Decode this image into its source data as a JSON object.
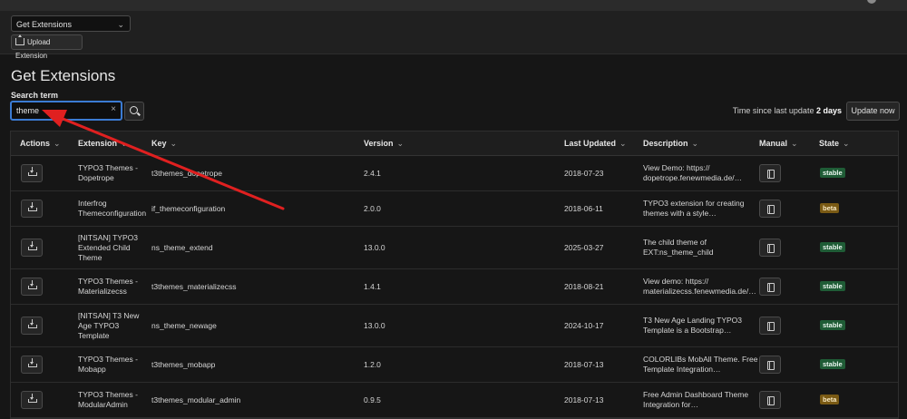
{
  "toolbar": {
    "select_value": "Get Extensions",
    "upload_label": "Upload Extension"
  },
  "page": {
    "title": "Get Extensions"
  },
  "search": {
    "label": "Search term",
    "value": "theme",
    "clear_symbol": "×"
  },
  "update": {
    "prefix": "Time since last update",
    "value": "2 days",
    "button_label": "Update now"
  },
  "columns": {
    "actions": "Actions",
    "extension": "Extension",
    "key": "Key",
    "version": "Version",
    "last_updated": "Last Updated",
    "description": "Description",
    "manual": "Manual",
    "state": "State"
  },
  "icons": {
    "sort": "chevron-down-icon",
    "action": "download-icon",
    "manual": "book-icon",
    "search": "search-icon",
    "upload": "upload-icon"
  },
  "colors": {
    "accent": "#3b7bd3",
    "stable": "#1f5c36",
    "beta": "#7a5a14",
    "annotation": "#e02020"
  },
  "rows": [
    {
      "extension": [
        "TYPO3 Themes -",
        "Dopetrope"
      ],
      "key": "t3themes_dopetrope",
      "version": "2.4.1",
      "last_updated": "2018-07-23",
      "description": [
        "View Demo: https://",
        "dopetrope.fenewmedia.de/…"
      ],
      "state": "stable"
    },
    {
      "extension": [
        "Interfrog",
        "Themeconfiguration"
      ],
      "key": "if_themeconfiguration",
      "version": "2.0.0",
      "last_updated": "2018-06-11",
      "description": [
        "TYPO3 extension for creating",
        "themes with a style…"
      ],
      "state": "beta"
    },
    {
      "extension": [
        "[NITSAN] TYPO3",
        "Extended Child",
        "Theme"
      ],
      "key": "ns_theme_extend",
      "version": "13.0.0",
      "last_updated": "2025-03-27",
      "description": [
        "The child theme of",
        "EXT:ns_theme_child"
      ],
      "state": "stable"
    },
    {
      "extension": [
        "TYPO3 Themes -",
        "Materializecss"
      ],
      "key": "t3themes_materializecss",
      "version": "1.4.1",
      "last_updated": "2018-08-21",
      "description": [
        "View demo: https://",
        "materializecss.fenewmedia.de/…"
      ],
      "state": "stable"
    },
    {
      "extension": [
        "[NITSAN] T3 New",
        "Age TYPO3",
        "Template"
      ],
      "key": "ns_theme_newage",
      "version": "13.0.0",
      "last_updated": "2024-10-17",
      "description": [
        "T3 New Age Landing TYPO3",
        "Template is a Bootstrap…"
      ],
      "state": "stable"
    },
    {
      "extension": [
        "TYPO3 Themes -",
        "Mobapp"
      ],
      "key": "t3themes_mobapp",
      "version": "1.2.0",
      "last_updated": "2018-07-13",
      "description": [
        "COLORLIBs MobAll Theme. Free",
        "Template Integration…"
      ],
      "state": "stable"
    },
    {
      "extension": [
        "TYPO3 Themes -",
        "ModularAdmin"
      ],
      "key": "t3themes_modular_admin",
      "version": "0.9.5",
      "last_updated": "2018-07-13",
      "description": [
        "Free Admin Dashboard Theme",
        "Integration for…"
      ],
      "state": "beta"
    }
  ]
}
